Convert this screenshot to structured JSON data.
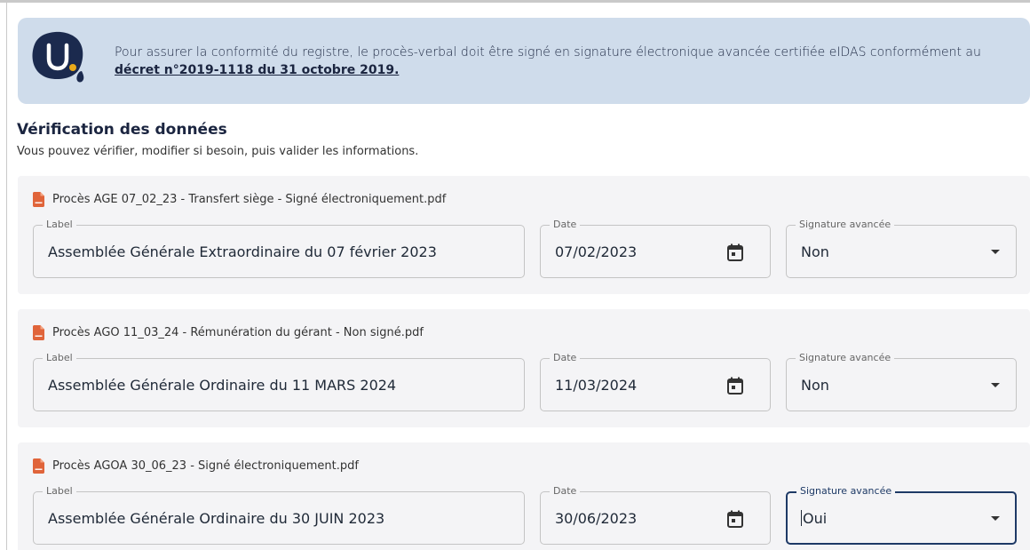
{
  "banner": {
    "text": "Pour assurer la conformité du registre, le procès-verbal doit être signé en signature électronique avancée certifiée eIDAS conformément au",
    "link": "décret n°2019-1118 du 31 octobre 2019.",
    "logo_letter": "U",
    "accent_color": "#e8a91a",
    "logo_color": "#1b2a4e"
  },
  "section": {
    "title": "Vérification des données",
    "subtitle": "Vous pouvez vérifier, modifier si besoin, puis valider les informations."
  },
  "labels": {
    "label": "Label",
    "date": "Date",
    "signature": "Signature avancée"
  },
  "documents": [
    {
      "file": "Procès AGE 07_02_23 - Transfert siège - Signé électroniquement.pdf",
      "label": "Assemblée Générale Extraordinaire du 07 février 2023",
      "date": "07/02/2023",
      "signature": "Non"
    },
    {
      "file": "Procès AGO 11_03_24 - Rémunération du gérant - Non signé.pdf",
      "label": "Assemblée Générale Ordinaire du 11 MARS 2024",
      "date": "11/03/2024",
      "signature": "Non"
    },
    {
      "file": "Procès AGOA 30_06_23 - Signé électroniquement.pdf",
      "label": "Assemblée Générale Ordinaire du 30 JUIN 2023",
      "date": "30/06/2023",
      "signature": "Oui"
    }
  ],
  "icons": {
    "file": "pdf-file-icon",
    "date": "calendar-icon",
    "select": "caret-down-icon"
  },
  "colors": {
    "pdf_icon": "#e0643a",
    "focus_border": "#1e3a66",
    "banner_bg": "#cfdceb"
  }
}
